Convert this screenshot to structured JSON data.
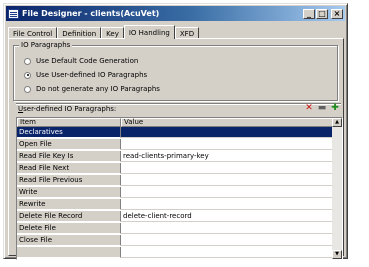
{
  "window": {
    "title": "File Designer - clients(AcuVet)"
  },
  "title_buttons": {
    "minimize": "_",
    "maximize": "□",
    "close": "×"
  },
  "tabs": [
    "File Control",
    "Definition",
    "Key",
    "IO Handling",
    "XFD"
  ],
  "active_tab": "IO Handling",
  "io_paragraphs": {
    "group_label": "IO Paragraphs",
    "options": [
      {
        "label": "Use Default Code Generation",
        "selected": false
      },
      {
        "label": "Use User-defined IO Paragraphs",
        "selected": true
      },
      {
        "label": "Do not generate any IO Paragraphs",
        "selected": false
      }
    ]
  },
  "grid": {
    "label_accel": "U",
    "label_rest": "ser-defined IO Paragraphs:",
    "toolbar_icons": [
      "delete-icon",
      "edit-icon",
      "add-icon"
    ],
    "columns": [
      "Item",
      "Value"
    ],
    "rows": [
      {
        "item": "Declaratives",
        "value": "",
        "selected": true
      },
      {
        "item": "Open File",
        "value": ""
      },
      {
        "item": "Read File Key Is",
        "value": "read-clients-primary-key"
      },
      {
        "item": "Read File Next",
        "value": ""
      },
      {
        "item": "Read File Previous",
        "value": ""
      },
      {
        "item": "Write",
        "value": ""
      },
      {
        "item": "Rewrite",
        "value": ""
      },
      {
        "item": "Delete File Record",
        "value": "delete-client-record"
      },
      {
        "item": "Delete File",
        "value": ""
      },
      {
        "item": "Close File",
        "value": ""
      },
      {
        "item": "",
        "value": ""
      }
    ],
    "scroll_up": "▲",
    "scroll_down": "▼"
  },
  "colors": {
    "titlebar_start": "#0a246a",
    "titlebar_end": "#a6caf0",
    "selection": "#0a246a",
    "face": "#d4d0c8"
  }
}
